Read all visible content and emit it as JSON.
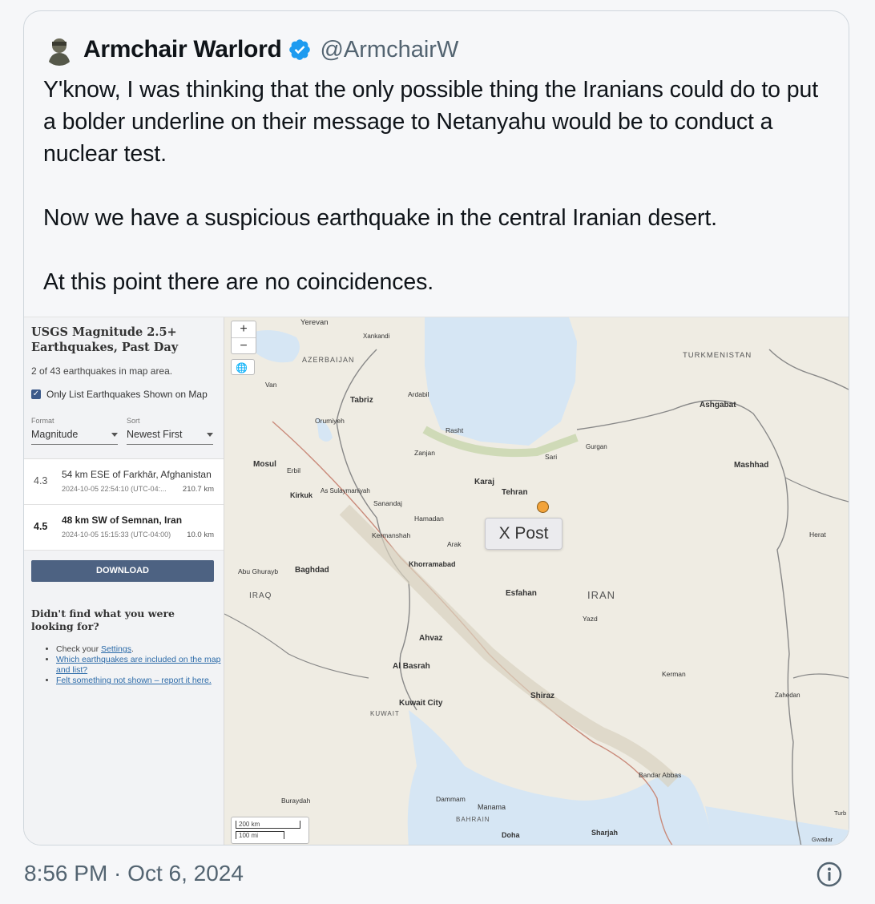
{
  "tweet": {
    "author_name": "Armchair Warlord",
    "handle": "@ArmchairW",
    "text": "Y'know, I was thinking that the only possible thing the Iranians could do to put a bolder underline on their message to Netanyahu would be to conduct a nuclear test.\n\nNow we have a suspicious earthquake in the central Iranian desert.\n\nAt this point there are no coincidences.",
    "timestamp": "8:56 PM · Oct 6, 2024",
    "icons": {
      "verified": "verified-badge-icon",
      "info": "info-icon",
      "avatar": "avatar"
    },
    "colors": {
      "verified": "#1d9bf0",
      "secondary_text": "#536471"
    }
  },
  "usgs": {
    "title": "USGS Magnitude 2.5+ Earthquakes, Past Day",
    "count_text": "2 of 43 earthquakes in map area.",
    "checkbox_label": "Only List Earthquakes Shown on Map",
    "format_label": "Format",
    "format_value": "Magnitude",
    "sort_label": "Sort",
    "sort_value": "Newest First",
    "earthquakes": [
      {
        "mag": "4.3",
        "place": "54 km ESE of Farkhār, Afghanistan",
        "time": "2024-10-05 22:54:10 (UTC-04:...",
        "depth": "210.7 km"
      },
      {
        "mag": "4.5",
        "place": "48 km SW of Semnan, Iran",
        "time": "2024-10-05 15:15:33 (UTC-04:00)",
        "depth": "10.0 km"
      }
    ],
    "download_label": "DOWNLOAD",
    "help_title": "Didn't find what you were looking for?",
    "help_items": [
      {
        "prefix": "Check your ",
        "link": "Settings",
        "suffix": "."
      },
      {
        "link": "Which earthquakes are included on the map and list?"
      },
      {
        "link": "Felt something not shown – report it here."
      }
    ]
  },
  "map": {
    "labels": {
      "yerevan": "Yerevan",
      "xankandi": "Xankandi",
      "azerbaijan": "AZERBAIJAN",
      "turkmenistan": "TURKMENISTAN",
      "van": "Van",
      "tabriz": "Tabriz",
      "ardabil": "Ardabil",
      "orumiyeh": "Orumiyeh",
      "rasht": "Rasht",
      "ashgabat": "Ashgabat",
      "gurgan": "Gurgan",
      "zanjan": "Zanjan",
      "sari": "Sari",
      "mosul": "Mosul",
      "erbil": "Erbil",
      "mashhad": "Mashhad",
      "karaj": "Karaj",
      "tehran": "Tehran",
      "kirkuk": "Kirkuk",
      "sulaymaniyah": "As Sulaymaniyah",
      "sanandaj": "Sanandaj",
      "hamadan": "Hamadan",
      "kermanshah": "Kermanshah",
      "herat": "Herat",
      "arak": "Arak",
      "khorramabad": "Khorramabad",
      "abu_ghurayb": "Abu Ghurayb",
      "baghdad": "Baghdad",
      "iraq": "IRAQ",
      "esfahan": "Esfahan",
      "iran": "IRAN",
      "yazd": "Yazd",
      "ahvaz": "Ahvaz",
      "basrah": "Al Basrah",
      "kerman": "Kerman",
      "shiraz": "Shiraz",
      "zahedan": "Zahedan",
      "kuwait_city": "Kuwait City",
      "kuwait": "KUWAIT",
      "bandar_abbas": "Bandar Abbas",
      "buraydah": "Buraydah",
      "dammam": "Dammam",
      "manama": "Manama",
      "bahrain": "BAHRAIN",
      "doha": "Doha",
      "sharjah": "Sharjah",
      "gwadar": "Gwadar",
      "turb": "Turb"
    },
    "zoom_in": "+",
    "zoom_out": "−",
    "scale_km": "200 km",
    "scale_mi": "100 mi",
    "popup": "X Post",
    "colors": {
      "water": "#d6e6f4",
      "land": "#efece3",
      "quake": "#f2a33a"
    }
  }
}
